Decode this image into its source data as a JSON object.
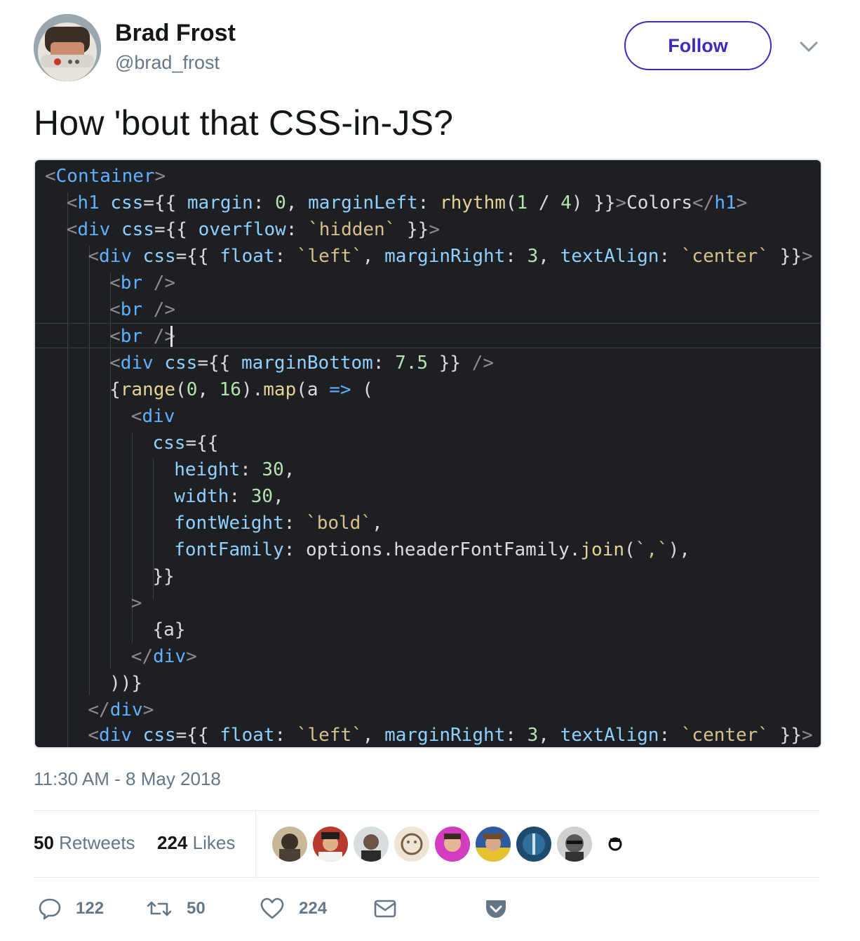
{
  "author": {
    "name": "Brad Frost",
    "handle": "@brad_frost",
    "follow_label": "Follow"
  },
  "tweet": {
    "text": "How 'bout that CSS-in-JS?",
    "timestamp": "11:30 AM - 8 May 2018"
  },
  "code_lines": [
    "<Container>",
    "  <h1 css={{ margin: 0, marginLeft: rhythm(1 / 4) }}>Colors</h1>",
    "  <div css={{ overflow: `hidden` }}>",
    "    <div css={{ float: `left`, marginRight: 3, textAlign: `center` }}>",
    "      <br />",
    "      <br />",
    "      <br />",
    "      <div css={{ marginBottom: 7.5 }} />",
    "      {range(0, 16).map(a => (",
    "        <div",
    "          css={{",
    "            height: 30,",
    "            width: 30,",
    "            fontWeight: `bold`,",
    "            fontFamily: options.headerFontFamily.join(`,`),",
    "          }}",
    "        >",
    "          {a}",
    "        </div>",
    "      ))}",
    "    </div>",
    "    <div css={{ float: `left`, marginRight: 3, textAlign: `center` }}>"
  ],
  "stats": {
    "retweets_count": "50",
    "retweets_label": "Retweets",
    "likes_count": "224",
    "likes_label": "Likes"
  },
  "likers": [
    "liker-avatar-1",
    "liker-avatar-2",
    "liker-avatar-3",
    "liker-avatar-4",
    "liker-avatar-5",
    "liker-avatar-6",
    "liker-avatar-7",
    "liker-avatar-8",
    "liker-avatar-9"
  ],
  "actions": {
    "replies": "122",
    "retweets": "50",
    "likes": "224"
  },
  "icons": {
    "reply": "reply-icon",
    "retweet": "retweet-icon",
    "like": "heart-icon",
    "dm": "envelope-icon",
    "pocket": "pocket-icon",
    "more": "chevron-down-icon"
  },
  "colors": {
    "follow_accent": "#3b2db8",
    "muted": "#657786",
    "code_bg": "#1e1f22"
  }
}
